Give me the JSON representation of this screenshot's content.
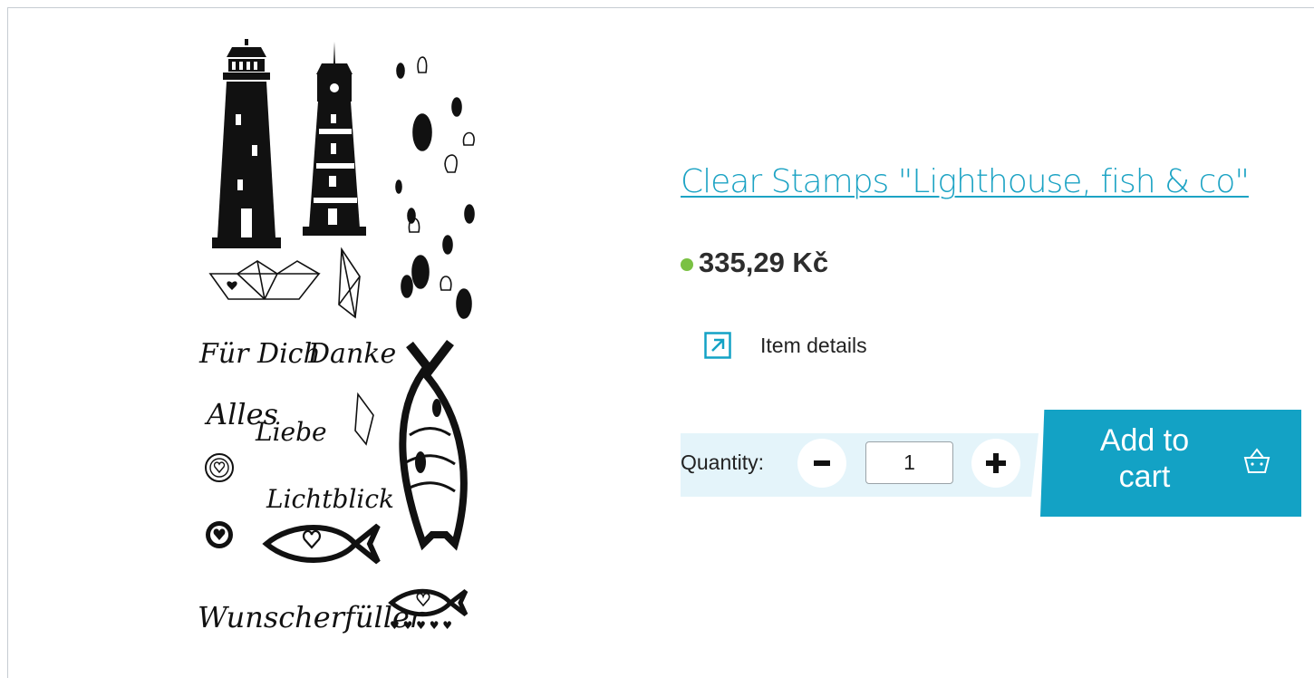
{
  "product": {
    "title": "Clear Stamps \"Lighthouse, fish & co\"",
    "price": "335,29 Kč",
    "stock_indicator_color": "#7ac143",
    "image_icon": "stamp-sheet-image",
    "image_alt": "Clear Stamps Lighthouse, fish & co"
  },
  "details": {
    "label": "Item details",
    "icon": "external-link-icon"
  },
  "quantity": {
    "label": "Quantity:",
    "value": "1",
    "minus_icon": "minus-icon",
    "plus_icon": "plus-icon"
  },
  "cart": {
    "label": "Add to cart",
    "icon": "basket-icon"
  },
  "colors": {
    "accent": "#13a2c5",
    "title_link": "#1ca3c4",
    "quantity_panel": "#e4f4fa",
    "in_stock": "#7ac143"
  }
}
